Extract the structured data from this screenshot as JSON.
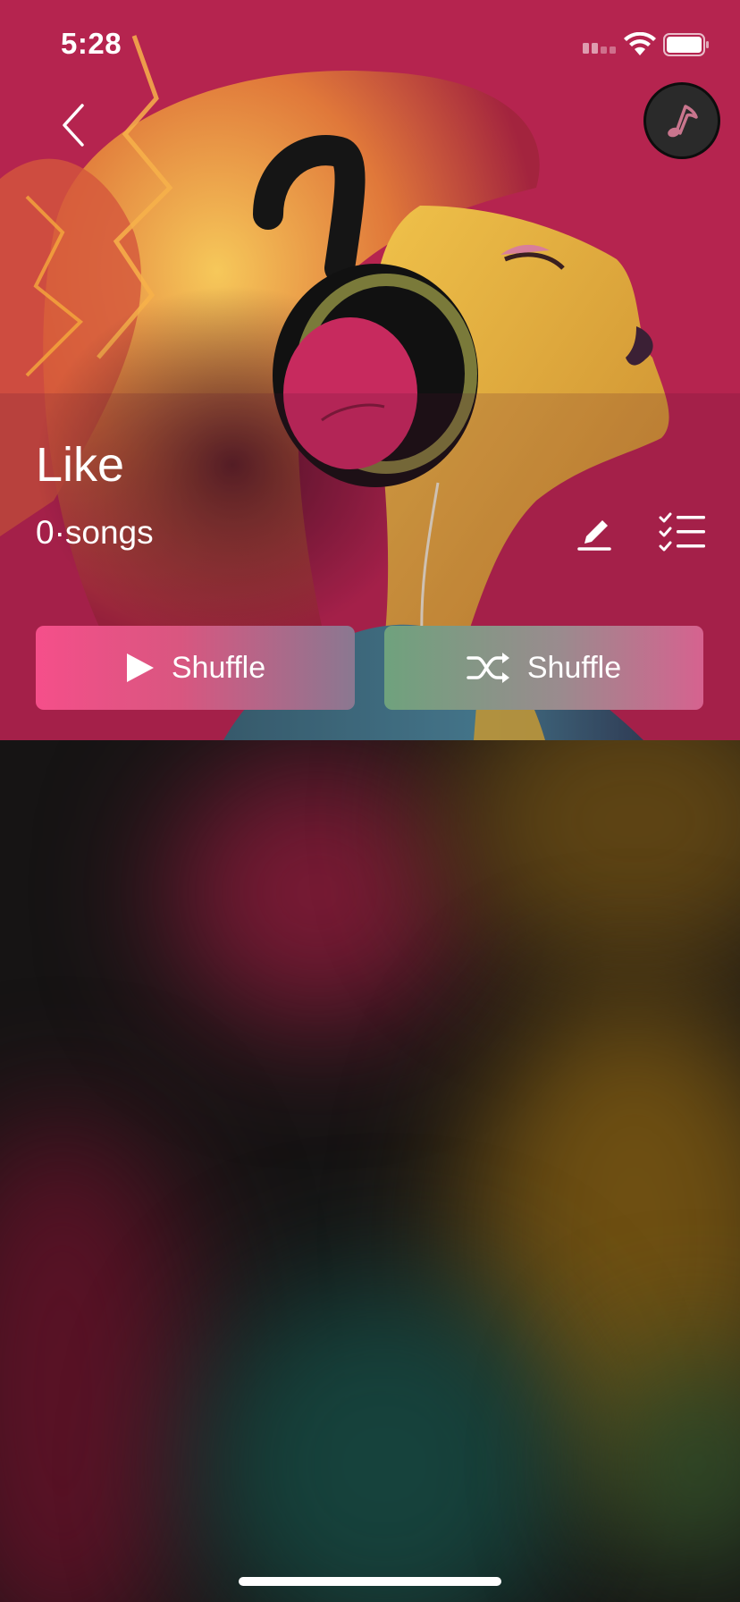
{
  "status_bar": {
    "time": "5:28"
  },
  "playlist": {
    "title": "Like",
    "song_count": "0·songs"
  },
  "actions": {
    "play_label": "Shuffle",
    "shuffle_label": "Shuffle"
  },
  "icons": {
    "back": "chevron-left-icon",
    "music": "music-note-icon",
    "edit": "pencil-icon",
    "select": "checklist-icon",
    "play": "play-icon",
    "shuffle": "shuffle-icon"
  },
  "colors": {
    "hero_background": "#b5244f",
    "play_button_start": "#f54f8a",
    "shuffle_button_start": "#6fa27d",
    "page_background": "#151313"
  }
}
